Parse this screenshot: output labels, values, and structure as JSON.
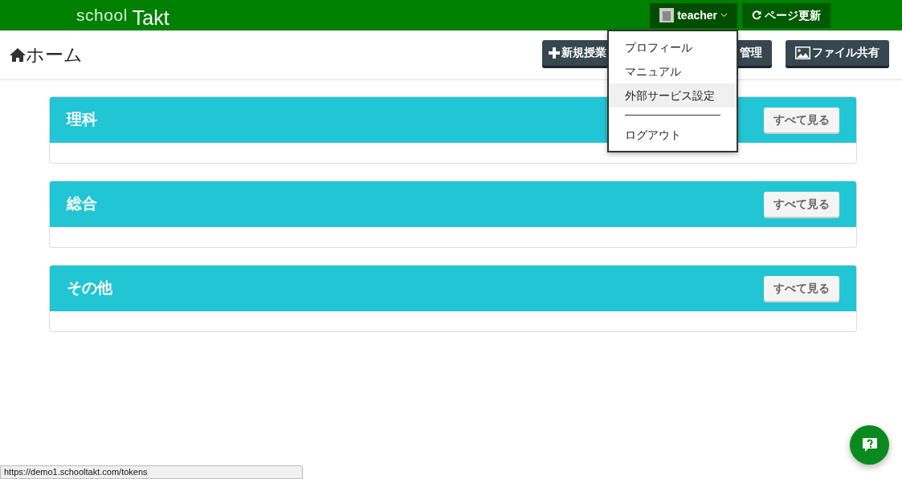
{
  "header": {
    "logo": {
      "part1": "school",
      "part2": "Takt"
    },
    "user_menu": {
      "label": "teacher",
      "expanded": true
    },
    "refresh_button": {
      "label": "ページ更新"
    }
  },
  "page": {
    "title": "ホーム"
  },
  "toolbar": [
    {
      "kind": "plus",
      "label": "新規授業"
    },
    {
      "kind": "plain",
      "label": "管理"
    },
    {
      "kind": "image",
      "label": "ファイル共有"
    }
  ],
  "dropdown": [
    {
      "kind": "item",
      "label": "プロフィール",
      "hovered": false
    },
    {
      "kind": "item",
      "label": "マニュアル",
      "hovered": false
    },
    {
      "kind": "item",
      "label": "外部サービス設定",
      "hovered": true
    },
    {
      "kind": "divider"
    },
    {
      "kind": "item",
      "label": "ログアウト",
      "hovered": false
    }
  ],
  "sections": [
    {
      "title": "理科",
      "button": "すべて見る"
    },
    {
      "title": "総合",
      "button": "すべて見る"
    },
    {
      "title": "その他",
      "button": "すべて見る"
    }
  ],
  "status_url": "https://demo1.schooltakt.com/tokens"
}
